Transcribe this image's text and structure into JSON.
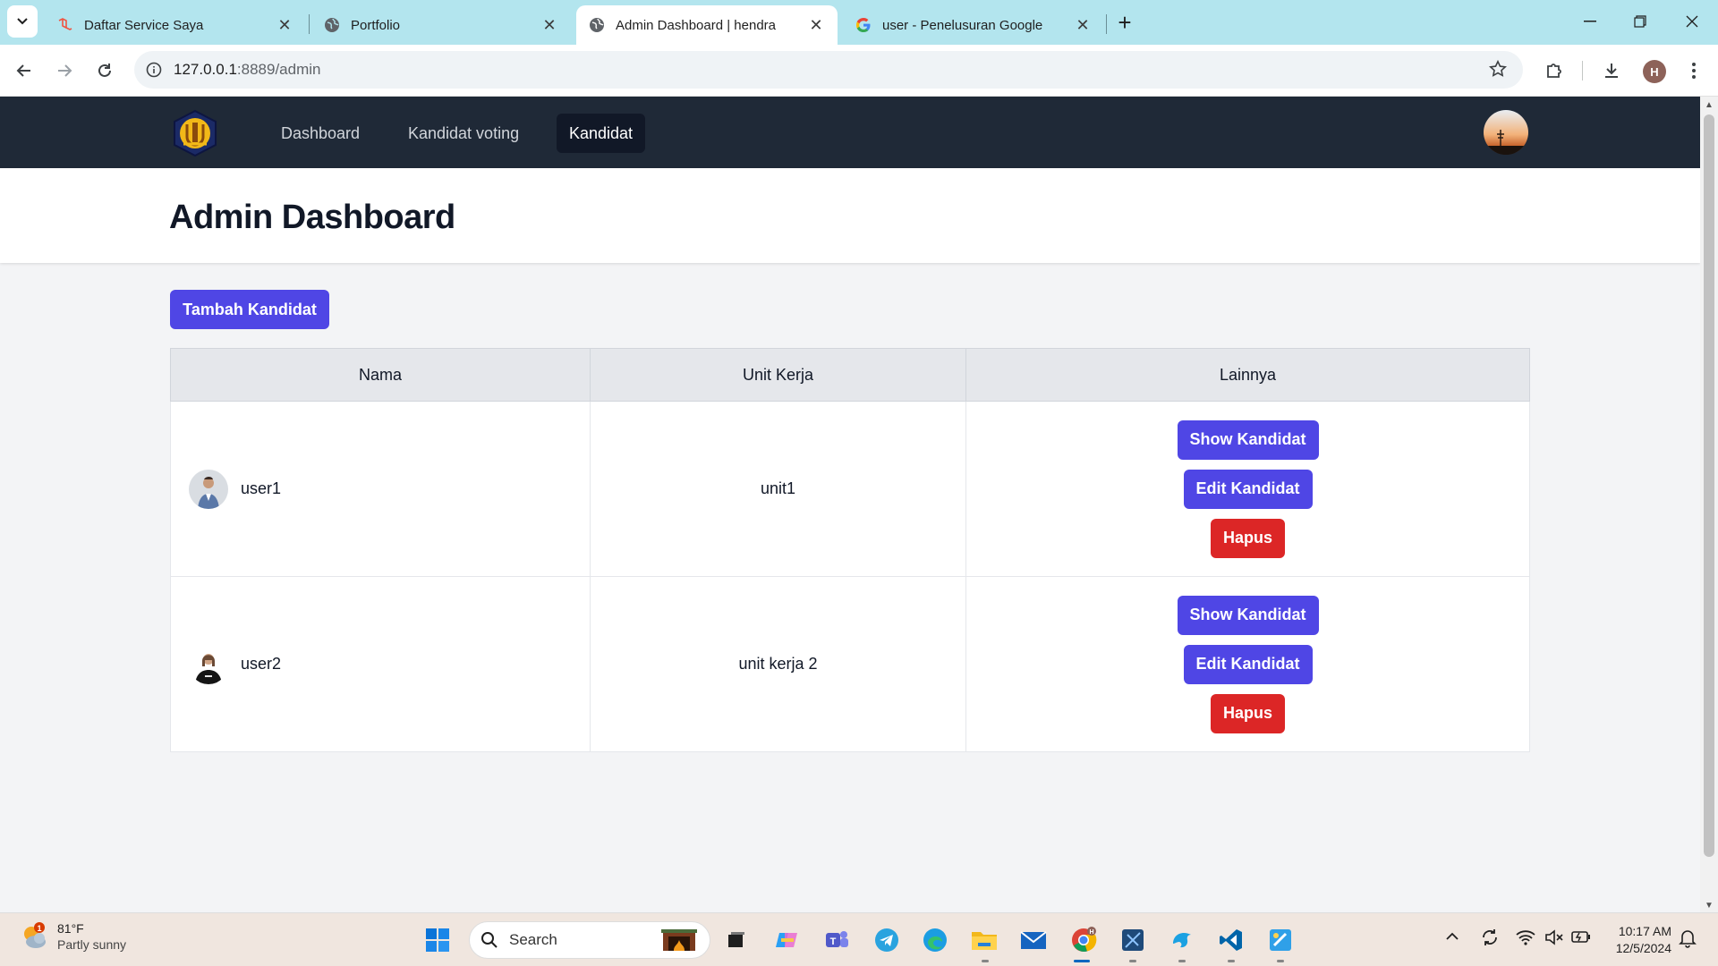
{
  "browser": {
    "tabs": [
      {
        "title": "Daftar Service Saya",
        "favicon": "laravel-icon",
        "active": false
      },
      {
        "title": "Portfolio",
        "favicon": "globe-icon",
        "active": false
      },
      {
        "title": "Admin Dashboard | hendra",
        "favicon": "globe-icon",
        "active": true
      },
      {
        "title": "user - Penelusuran Google",
        "favicon": "google-icon",
        "active": false
      }
    ],
    "url_host": "127.0.0.1",
    "url_path": ":8889/admin",
    "profile_initial": "H",
    "accent": "#b3e5ee"
  },
  "nav": {
    "links": [
      "Dashboard",
      "Kandidat voting",
      "Kandidat"
    ],
    "active": "Kandidat",
    "bg": "#1f2937"
  },
  "page": {
    "title": "Admin Dashboard",
    "add_button": "Tambah Kandidat"
  },
  "table": {
    "headers": [
      "Nama",
      "Unit Kerja",
      "Lainnya"
    ],
    "rows": [
      {
        "name": "user1",
        "unit": "unit1"
      },
      {
        "name": "user2",
        "unit": "unit kerja 2"
      }
    ],
    "actions": {
      "show": "Show Kandidat",
      "edit": "Edit Kandidat",
      "delete": "Hapus"
    },
    "colors": {
      "primary": "#4f46e5",
      "danger": "#dc2626"
    }
  },
  "taskbar": {
    "weather_badge": "1",
    "weather_temp": "81°F",
    "weather_cond": "Partly sunny",
    "search_label": "Search",
    "time": "10:17 AM",
    "date": "12/5/2024"
  }
}
